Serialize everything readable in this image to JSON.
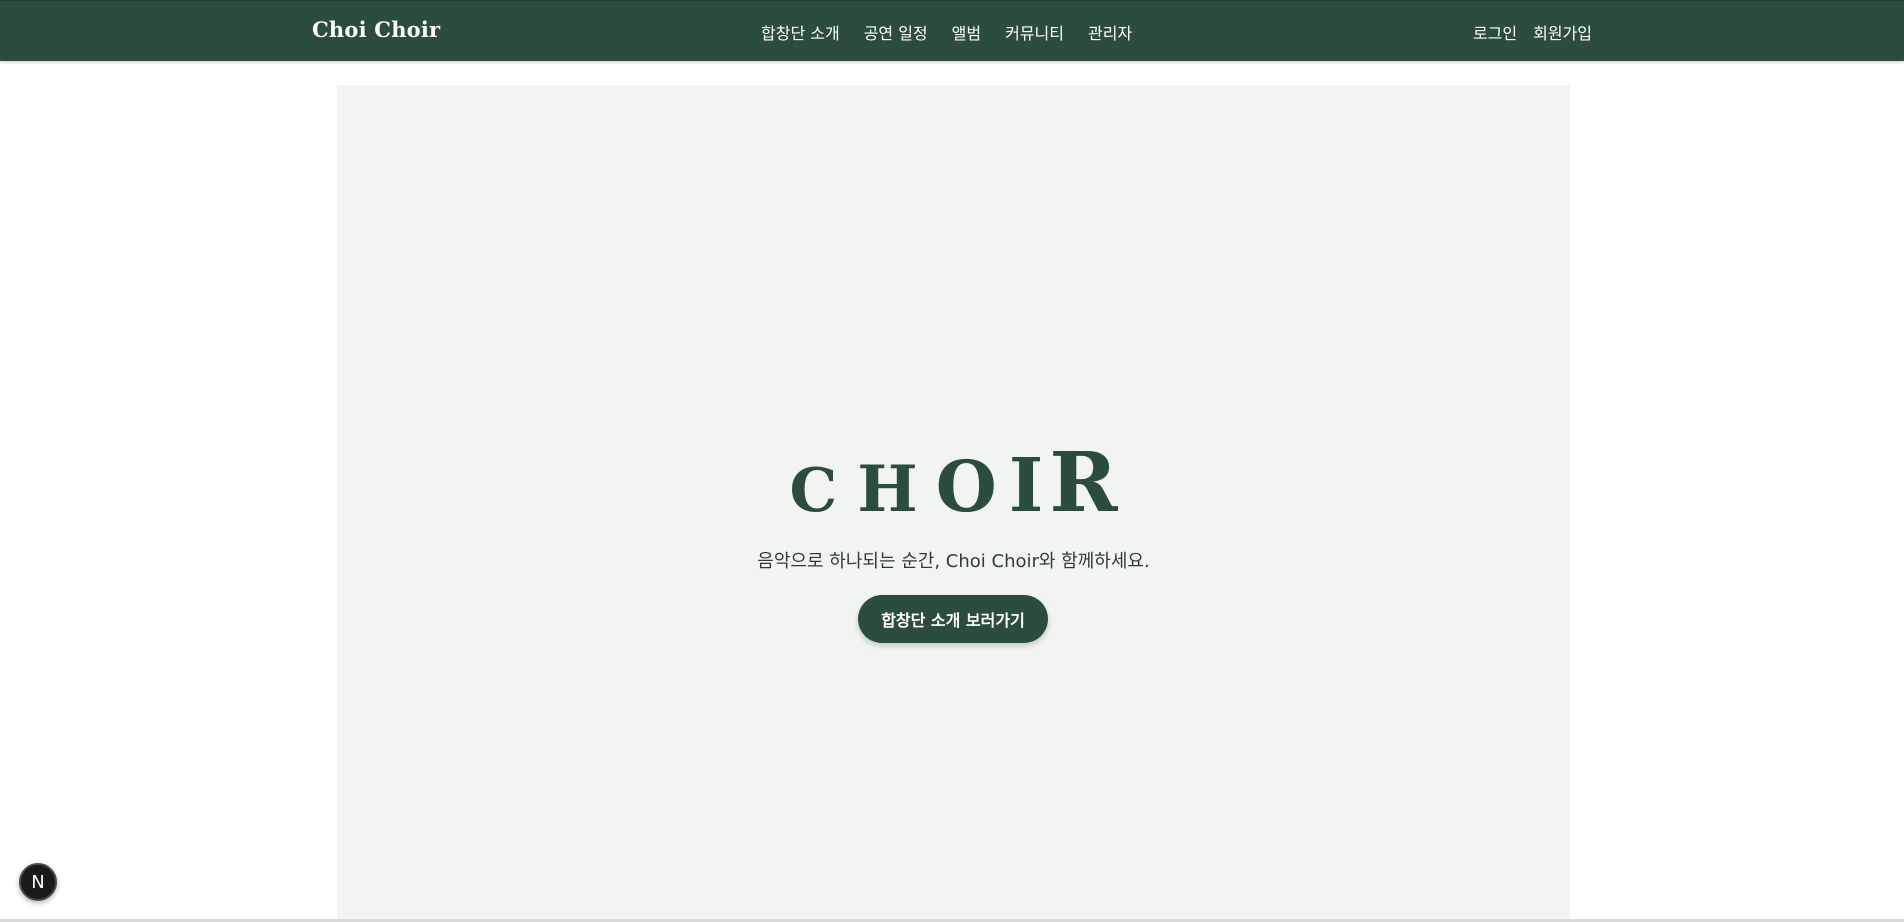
{
  "nav": {
    "brand": "Choi Choir",
    "links": [
      {
        "label": "합창단 소개"
      },
      {
        "label": "공연 일정"
      },
      {
        "label": "앨범"
      },
      {
        "label": "커뮤니티"
      },
      {
        "label": "관리자"
      }
    ],
    "auth": {
      "login": "로그인",
      "signup": "회원가입"
    }
  },
  "hero": {
    "title_letters": [
      "C",
      "H",
      "O",
      "I",
      "R"
    ],
    "subtitle": "음악으로 하나되는 순간, Choi Choir와 함께하세요.",
    "button_label": "합창단 소개 보러가기"
  },
  "dev_badge": {
    "label": "N"
  },
  "colors": {
    "primary": "#2d4d3c",
    "hero_bg": "#f2f4f1",
    "text": "#333a36"
  }
}
